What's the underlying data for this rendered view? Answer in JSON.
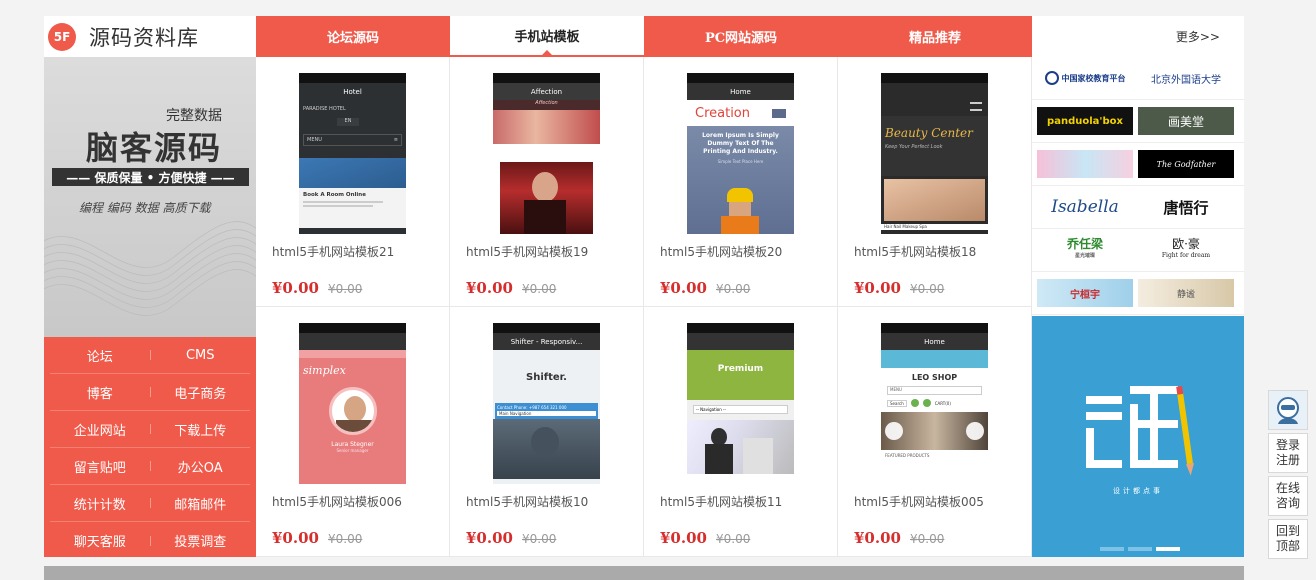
{
  "header": {
    "logo_badge": "5F",
    "logo_text": "源码资料库",
    "tabs": [
      "论坛源码",
      "手机站模板",
      "PC网站源码",
      "精品推荐"
    ],
    "active_tab": 1,
    "more": "更多>>"
  },
  "banner": {
    "line1": "完整数据",
    "line2": "脑客源码",
    "line3": "—— 保质保量 • 方便快捷 ——",
    "line4": "编程 编码 数据  高质下载"
  },
  "left_nav": [
    [
      "论坛",
      "CMS"
    ],
    [
      "博客",
      "电子商务"
    ],
    [
      "企业网站",
      "下载上传"
    ],
    [
      "留言贴吧",
      "办公OA"
    ],
    [
      "统计计数",
      "邮箱邮件"
    ],
    [
      "聊天客服",
      "投票调查"
    ]
  ],
  "products": [
    {
      "title": "html5手机网站模板21",
      "price": "¥0.00",
      "old": "¥0.00",
      "screen_title": "Hotel",
      "theme": "hotel"
    },
    {
      "title": "html5手机网站模板19",
      "price": "¥0.00",
      "old": "¥0.00",
      "screen_title": "Affection",
      "theme": "affection"
    },
    {
      "title": "html5手机网站模板20",
      "price": "¥0.00",
      "old": "¥0.00",
      "screen_title": "Home",
      "theme": "creation"
    },
    {
      "title": "html5手机网站模板18",
      "price": "¥0.00",
      "old": "¥0.00",
      "screen_title": "",
      "theme": "beauty"
    },
    {
      "title": "html5手机网站模板006",
      "price": "¥0.00",
      "old": "¥0.00",
      "screen_title": "",
      "theme": "simplex"
    },
    {
      "title": "html5手机网站模板10",
      "price": "¥0.00",
      "old": "¥0.00",
      "screen_title": "Shifter - Responsiv...",
      "theme": "shifter"
    },
    {
      "title": "html5手机网站模板11",
      "price": "¥0.00",
      "old": "¥0.00",
      "screen_title": "",
      "theme": "premium"
    },
    {
      "title": "html5手机网站模板005",
      "price": "¥0.00",
      "old": "¥0.00",
      "screen_title": "Home",
      "theme": "leo"
    }
  ],
  "screens": {
    "hotel": {
      "brand": "PARADISE HOTEL",
      "lang": "EN",
      "menu": "MENU",
      "book": "Book A Room Online"
    },
    "affection": {
      "brand": "Affection"
    },
    "creation": {
      "brand": "Creation",
      "headline": "Lorem Ipsum Is Simply Dummy Text Of The Printing And Industry.",
      "sub": "Simple Text Place Here"
    },
    "beauty": {
      "brand": "Beauty Center",
      "sub": "Keep Your Perfect Look",
      "tabs": "Hair  Nail  Makeup  Spa"
    },
    "simplex": {
      "brand": "simplex",
      "person": "Laura Stegner",
      "role": "Senior manager"
    },
    "shifter": {
      "brand": "Shifter.",
      "contact": "Contact Phone: +987 654 321 000",
      "nav": "Main Navigation"
    },
    "premium": {
      "brand": "Premium",
      "nav": "-- Navigation --"
    },
    "leo": {
      "brand": "LEO SHOP",
      "menu": "MENU",
      "search": "Search",
      "cart": "CART(0)",
      "featured": "FEATURED PRODUCTS"
    }
  },
  "partners": [
    [
      "中国家校教育平台",
      "北京外国语大学"
    ],
    [
      "panduola'box",
      "画美堂"
    ],
    [
      "",
      "The Godfather"
    ],
    [
      "Isabella",
      "唐悟行"
    ],
    [
      "乔任梁",
      "欧·豪"
    ],
    [
      "宁桓宇",
      "静谧"
    ]
  ],
  "partner_sub": [
    "",
    "",
    "",
    "",
    "星光璀璨",
    "Fight for dream"
  ],
  "slide": {
    "text": "设计都点事",
    "dots": 3,
    "active_dot": 2
  },
  "side": {
    "login": "登录",
    "register": "注册",
    "consult1": "在线",
    "consult2": "咨询",
    "top1": "回到",
    "top2": "顶部"
  },
  "colors": {
    "accent": "#f05a4b",
    "price": "#d62d2d",
    "slide": "#3aa0d3"
  }
}
